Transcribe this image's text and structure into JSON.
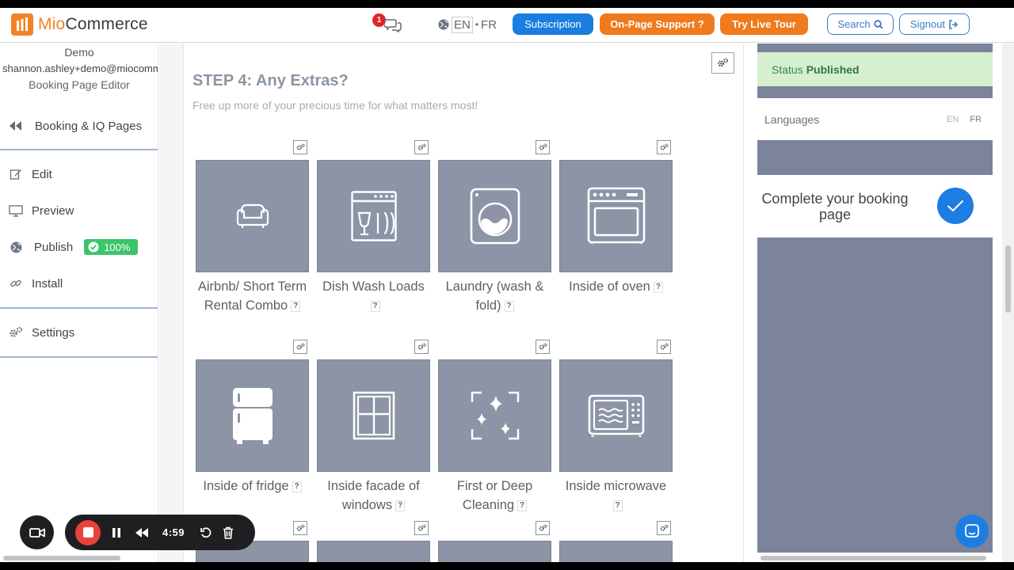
{
  "brand": {
    "name_prefix": "Mio",
    "name_suffix": "Commerce"
  },
  "header": {
    "notification_count": "1",
    "lang_en": "EN",
    "lang_fr": "FR",
    "subscription": "Subscription",
    "support": "On-Page Support ?",
    "tour": "Try Live Tour",
    "search": "Search",
    "signout": "Signout"
  },
  "sidebar": {
    "user_name": "Demo",
    "user_email": "shannon.ashley+demo@miocommerce.com",
    "user_role": "Booking Page Editor",
    "back_label": "Booking & IQ Pages",
    "items": [
      {
        "label": "Edit"
      },
      {
        "label": "Preview"
      },
      {
        "label": "Publish",
        "badge": "100%"
      },
      {
        "label": "Install"
      },
      {
        "label": "Settings"
      }
    ]
  },
  "main": {
    "title": "STEP 4: Any Extras?",
    "subtitle": "Free up more of your precious time for what matters most!",
    "help_mark": "?",
    "extras": [
      {
        "label": "Airbnb/ Short Term Rental Combo",
        "icon": "sofa-icon"
      },
      {
        "label": "Dish Wash Loads",
        "icon": "dishwasher-icon"
      },
      {
        "label": "Laundry (wash & fold)",
        "icon": "washing-machine-icon"
      },
      {
        "label": "Inside of oven",
        "icon": "oven-icon"
      },
      {
        "label": "Inside of fridge",
        "icon": "fridge-icon"
      },
      {
        "label": "Inside facade of windows",
        "icon": "window-icon"
      },
      {
        "label": "First or Deep Cleaning",
        "icon": "sparkle-icon"
      },
      {
        "label": "Inside microwave",
        "icon": "microwave-icon"
      }
    ]
  },
  "right_panel": {
    "status_label": "Status",
    "status_value": "Published",
    "languages_label": "Languages",
    "lang_en": "EN",
    "lang_fr": "FR",
    "complete_text": "Complete your booking page"
  },
  "recorder": {
    "time": "4:59"
  },
  "colors": {
    "brand_orange": "#f08426",
    "primary_blue": "#1a7de0",
    "tile_gray": "#8c94a6",
    "panel_slate": "#7b849b",
    "success_green": "#3cc46a",
    "record_red": "#e8423a"
  }
}
